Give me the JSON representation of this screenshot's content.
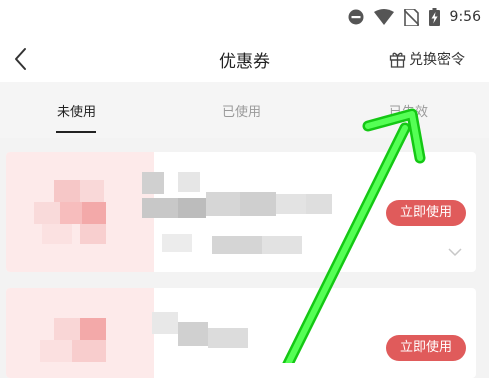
{
  "status_bar": {
    "time": "9:56",
    "icons": [
      "do-not-disturb-icon",
      "wifi-icon",
      "no-sim-icon",
      "battery-charging-icon"
    ]
  },
  "nav": {
    "title": "优惠券",
    "back_icon": "back-arrow-icon",
    "redeem_icon": "gift-icon",
    "redeem_label": "兑换密令"
  },
  "tabs": [
    {
      "label": "未使用",
      "active": true
    },
    {
      "label": "已使用",
      "active": false
    },
    {
      "label": "已失效",
      "active": false
    }
  ],
  "coupons": [
    {
      "button_label": "立即使用",
      "expand_icon": "chevron-down-icon"
    },
    {
      "button_label": "立即使用"
    }
  ],
  "overlay": {
    "arrow_color": "#22dd22"
  },
  "colors": {
    "accent": "#e05b5b",
    "card_left": "#fdeaea",
    "tabs_background": "#f5f5f5",
    "page_background": "#f3f3f3"
  }
}
